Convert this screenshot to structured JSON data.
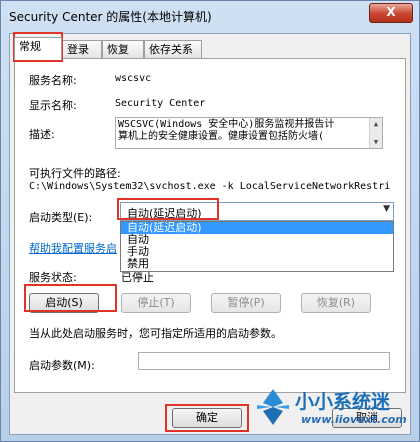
{
  "window": {
    "title": "Security Center 的属性(本地计算机)",
    "close_label": "X"
  },
  "tabs": [
    {
      "label": "常规"
    },
    {
      "label": "登录"
    },
    {
      "label": "恢复"
    },
    {
      "label": "依存关系"
    }
  ],
  "general": {
    "service_name_label": "服务名称:",
    "service_name_value": "wscsvc",
    "display_name_label": "显示名称:",
    "display_name_value": "Security Center",
    "description_label": "描述:",
    "description_line1": "WSCSVC(Windows 安全中心)服务监视并报告计",
    "description_line2": "算机上的安全健康设置。健康设置包括防火墙(",
    "exe_path_label": "可执行文件的路径:",
    "exe_path_value": "C:\\Windows\\System32\\svchost.exe -k LocalServiceNetworkRestri",
    "startup_type_label": "启动类型(E):",
    "startup_type_value": "自动(延迟启动)",
    "startup_options": [
      "自动(延迟启动)",
      "自动",
      "手动",
      "禁用"
    ],
    "help_link": "帮助我配置服务启",
    "status_label": "服务状态:",
    "status_value": "已停止",
    "start_button": "启动(S)",
    "stop_button": "停止(T)",
    "pause_button": "暂停(P)",
    "resume_button": "恢复(R)",
    "hint_text": "当从此处启动服务时，您可指定所适用的启动参数。",
    "params_label": "启动参数(M):"
  },
  "footer": {
    "ok_button": "确定",
    "cancel_button": "取消"
  },
  "watermark": {
    "brand": "小小系统迷",
    "url": "www.iiovext.com"
  },
  "colors": {
    "highlight": "#e0342b",
    "selection": "#3399ff",
    "link": "#0066cc"
  }
}
